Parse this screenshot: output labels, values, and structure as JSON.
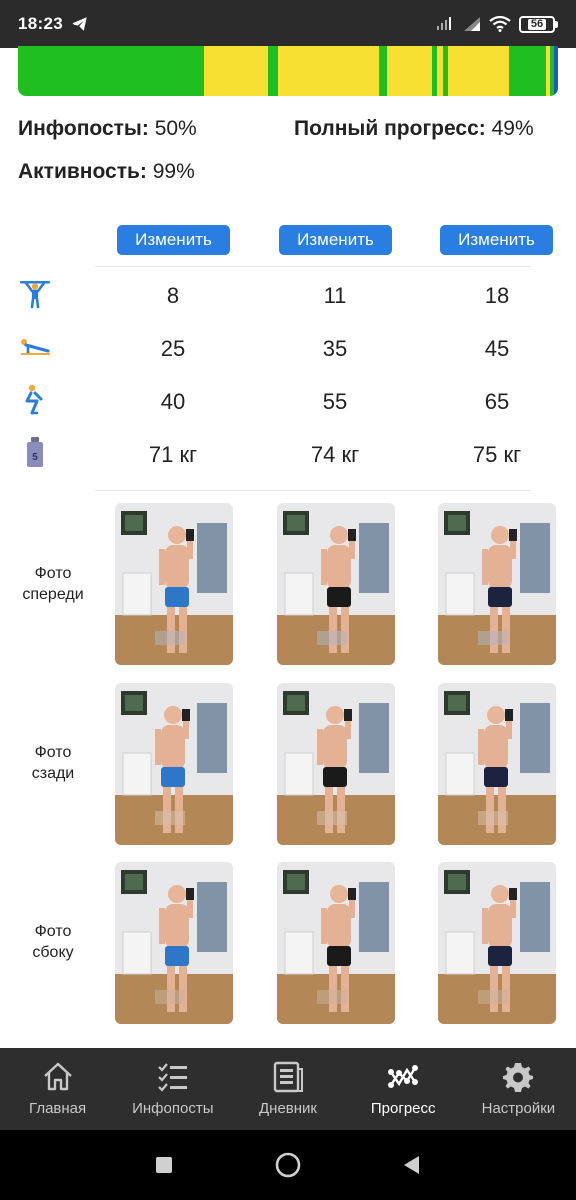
{
  "status_bar": {
    "time": "18:23",
    "battery": "56"
  },
  "progress_strip": {
    "segments": [
      {
        "color": "#1fbf1f",
        "fraction": 0.34
      },
      {
        "color": "#1fbf1f",
        "fraction": 0.012
      },
      {
        "color": "#f7e032",
        "fraction": 0.12
      },
      {
        "color": "#1fbf1f",
        "fraction": 0.02
      },
      {
        "color": "#f7e032",
        "fraction": 0.19
      },
      {
        "color": "#1fbf1f",
        "fraction": 0.015
      },
      {
        "color": "#f7e032",
        "fraction": 0.085
      },
      {
        "color": "#1fbf1f",
        "fraction": 0.01
      },
      {
        "color": "#f7e032",
        "fraction": 0.01
      },
      {
        "color": "#1fbf1f",
        "fraction": 0.01
      },
      {
        "color": "#f7e032",
        "fraction": 0.115
      },
      {
        "color": "#1fbf1f",
        "fraction": 0.07
      },
      {
        "color": "#f7e032",
        "fraction": 0.009
      },
      {
        "color": "#1fbf1f",
        "fraction": 0.006
      },
      {
        "color": "#1e56c8",
        "fraction": 0.008
      }
    ]
  },
  "stats": {
    "infoposts_label": "Инфопосты:",
    "infoposts_value": "50%",
    "full_progress_label": "Полный прогресс:",
    "full_progress_value": "49%",
    "activity_label": "Активность:",
    "activity_value": "99%"
  },
  "columns": {
    "edit_label": "Изменить",
    "rows": [
      {
        "icon": "pullup-icon",
        "values": [
          "8",
          "11",
          "18"
        ]
      },
      {
        "icon": "pushup-icon",
        "values": [
          "25",
          "35",
          "45"
        ]
      },
      {
        "icon": "squat-icon",
        "values": [
          "40",
          "55",
          "65"
        ]
      },
      {
        "icon": "weight-icon",
        "values": [
          "71 кг",
          "74 кг",
          "75 кг"
        ]
      }
    ],
    "weight_icon_number": "5"
  },
  "photos": {
    "front_label_1": "Фото",
    "front_label_2": "спереди",
    "back_label_1": "Фото",
    "back_label_2": "сзади",
    "side_label_1": "Фото",
    "side_label_2": "сбоку"
  },
  "bottom_nav": [
    {
      "label": "Главная",
      "icon": "home-icon"
    },
    {
      "label": "Инфопосты",
      "icon": "checklist-icon"
    },
    {
      "label": "Дневник",
      "icon": "journal-icon"
    },
    {
      "label": "Прогресс",
      "icon": "progress-graph-icon",
      "active": true
    },
    {
      "label": "Настройки",
      "icon": "gear-icon"
    }
  ]
}
